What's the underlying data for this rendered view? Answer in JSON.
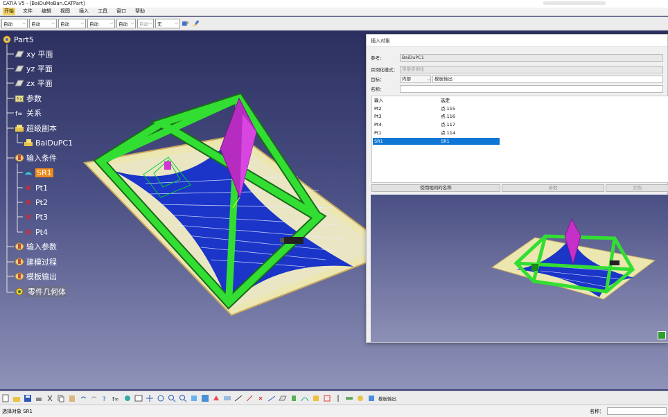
{
  "window": {
    "title": "CATIA V5 - [BaiDuMoBan.CATPart]"
  },
  "menubar": {
    "items": [
      "开始",
      "文件",
      "编辑",
      "视图",
      "插入",
      "工具",
      "窗口",
      "帮助"
    ]
  },
  "toolbar_top": {
    "combos": [
      {
        "value": "自动"
      },
      {
        "value": "自动"
      },
      {
        "value": "自动"
      },
      {
        "value": "自动"
      },
      {
        "value": "自动"
      },
      {
        "value": "自动"
      },
      {
        "value": "无"
      }
    ]
  },
  "tree": {
    "items": [
      {
        "label": "Part5",
        "icon": "part-gear-icon"
      },
      {
        "label": "xy 平面",
        "icon": "plane-icon"
      },
      {
        "label": "yz 平面",
        "icon": "plane-icon"
      },
      {
        "label": "zx 平面",
        "icon": "plane-icon"
      },
      {
        "label": "参数",
        "icon": "parameters-icon"
      },
      {
        "label": "关系",
        "icon": "relations-icon"
      },
      {
        "label": "超级副本",
        "icon": "powercopy-folder-icon"
      },
      {
        "label": "BaiDuPC1",
        "icon": "powercopy-icon"
      },
      {
        "label": "输入条件",
        "icon": "geometric-set-icon"
      },
      {
        "label": "SR1",
        "icon": "surface-icon"
      },
      {
        "label": "Pt1",
        "icon": "point-icon"
      },
      {
        "label": "Pt2",
        "icon": "point-icon"
      },
      {
        "label": "Pt3",
        "icon": "point-icon"
      },
      {
        "label": "Pt4",
        "icon": "point-icon"
      },
      {
        "label": "输入参数",
        "icon": "geometric-set-icon"
      },
      {
        "label": "建模过程",
        "icon": "geometric-set-icon"
      },
      {
        "label": "模板输出",
        "icon": "geometric-set-icon"
      },
      {
        "label": "零件几何体",
        "icon": "body-icon"
      }
    ]
  },
  "dialog": {
    "title": "插入对象",
    "reference_label": "参考：",
    "reference_value": "BaiDuPC1",
    "instantiation_label": "实例化模式：",
    "instantiation_value": "带参实例化",
    "target_label": "目标：",
    "target_value": "内部",
    "target_extra": "模板输出",
    "name_label": "名称：",
    "name_value": "",
    "list_header": {
      "col1": "输入",
      "col2": "选定"
    },
    "list_rows": [
      {
        "input": "Pt2",
        "selected": "点.115"
      },
      {
        "input": "Pt3",
        "selected": "点.116"
      },
      {
        "input": "Pt4",
        "selected": "点.117"
      },
      {
        "input": "Pt1",
        "selected": "点.114"
      },
      {
        "input": "SR1",
        "selected": "SR1"
      }
    ],
    "buttons": {
      "use_same_name": "使用相同的名称",
      "parameters": "参数",
      "documents": "文档"
    }
  },
  "statusbar": {
    "text": "选择对象 SR1",
    "cmd_label": "名称："
  },
  "colors": {
    "viewport_top": "#2c3060",
    "frame_green": "#2fd12f",
    "membrane_blue": "#1a35c8",
    "base_plate": "#ece6b0",
    "spike": "#c62fc8",
    "selection": "#0e76d4",
    "tree_highlight": "#f08a18"
  }
}
